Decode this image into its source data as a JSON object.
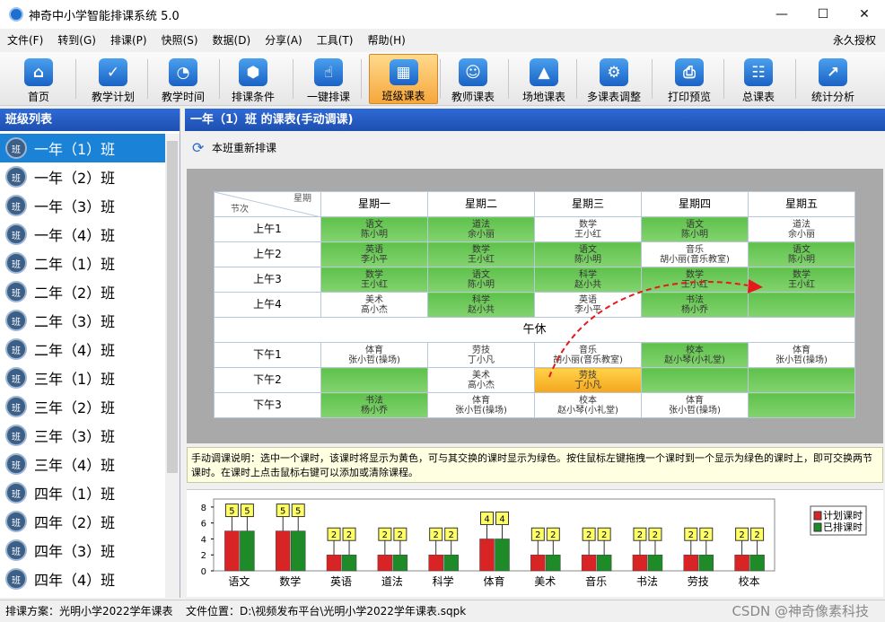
{
  "window": {
    "title": "神奇中小学智能排课系统 5.0",
    "minimize": "—",
    "maximize": "☐",
    "close": "✕"
  },
  "menu": {
    "items": [
      "文件(F)",
      "转到(G)",
      "排课(P)",
      "快照(S)",
      "数据(D)",
      "分享(A)",
      "工具(T)",
      "帮助(H)"
    ],
    "license": "永久授权"
  },
  "toolbar": {
    "buttons": [
      "首页",
      "教学计划",
      "教学时间",
      "排课条件",
      "一键排课",
      "班级课表",
      "教师课表",
      "场地课表",
      "多课表调整",
      "打印预览",
      "总课表",
      "统计分析"
    ],
    "active": "班级课表"
  },
  "left": {
    "title": "班级列表",
    "classes": [
      "一年（1）班",
      "一年（2）班",
      "一年（3）班",
      "一年（4）班",
      "二年（1）班",
      "二年（2）班",
      "二年（3）班",
      "二年（4）班",
      "三年（1）班",
      "三年（2）班",
      "三年（3）班",
      "三年（4）班",
      "四年（1）班",
      "四年（2）班",
      "四年（3）班",
      "四年（4）班"
    ],
    "selected": "一年（1）班",
    "icon_text": "班"
  },
  "right": {
    "title": "一年（1）班 的课表(手动调课)",
    "rebuild": "本班重新排课"
  },
  "schedule": {
    "corner_top": "星期",
    "corner_bottom": "节次",
    "days": [
      "星期一",
      "星期二",
      "星期三",
      "星期四",
      "星期五"
    ],
    "noon": "午休",
    "rows": [
      {
        "label": "上午1",
        "cells": [
          {
            "t": "语文",
            "s": "陈小明",
            "c": "g"
          },
          {
            "t": "道法",
            "s": "余小丽",
            "c": "g"
          },
          {
            "t": "数学",
            "s": "王小红",
            "c": ""
          },
          {
            "t": "语文",
            "s": "陈小明",
            "c": "g"
          },
          {
            "t": "道法",
            "s": "余小丽",
            "c": ""
          }
        ]
      },
      {
        "label": "上午2",
        "cells": [
          {
            "t": "英语",
            "s": "李小平",
            "c": "g"
          },
          {
            "t": "数学",
            "s": "王小红",
            "c": "g"
          },
          {
            "t": "语文",
            "s": "陈小明",
            "c": "g"
          },
          {
            "t": "音乐",
            "s": "胡小丽(音乐教室)",
            "c": ""
          },
          {
            "t": "语文",
            "s": "陈小明",
            "c": "g"
          }
        ]
      },
      {
        "label": "上午3",
        "cells": [
          {
            "t": "数学",
            "s": "王小红",
            "c": "g"
          },
          {
            "t": "语文",
            "s": "陈小明",
            "c": "g"
          },
          {
            "t": "科学",
            "s": "赵小共",
            "c": "g"
          },
          {
            "t": "数学",
            "s": "王小红",
            "c": "g"
          },
          {
            "t": "数学",
            "s": "王小红",
            "c": "g"
          }
        ]
      },
      {
        "label": "上午4",
        "cells": [
          {
            "t": "美术",
            "s": "高小杰",
            "c": ""
          },
          {
            "t": "科学",
            "s": "赵小共",
            "c": "g"
          },
          {
            "t": "英语",
            "s": "李小平",
            "c": ""
          },
          {
            "t": "书法",
            "s": "杨小乔",
            "c": "g"
          },
          {
            "t": "",
            "s": "",
            "c": "g"
          }
        ]
      },
      {
        "label": "下午1",
        "cells": [
          {
            "t": "体育",
            "s": "张小哲(操场)",
            "c": ""
          },
          {
            "t": "劳技",
            "s": "丁小凡",
            "c": ""
          },
          {
            "t": "音乐",
            "s": "胡小丽(音乐教室)",
            "c": ""
          },
          {
            "t": "校本",
            "s": "赵小琴(小礼堂)",
            "c": "g"
          },
          {
            "t": "体育",
            "s": "张小哲(操场)",
            "c": ""
          }
        ]
      },
      {
        "label": "下午2",
        "cells": [
          {
            "t": "",
            "s": "",
            "c": "g"
          },
          {
            "t": "美术",
            "s": "高小杰",
            "c": ""
          },
          {
            "t": "劳技",
            "s": "丁小凡",
            "c": "y"
          },
          {
            "t": "",
            "s": "",
            "c": "g"
          },
          {
            "t": "",
            "s": "",
            "c": "g"
          }
        ]
      },
      {
        "label": "下午3",
        "cells": [
          {
            "t": "书法",
            "s": "杨小乔",
            "c": "g"
          },
          {
            "t": "体育",
            "s": "张小哲(操场)",
            "c": ""
          },
          {
            "t": "校本",
            "s": "赵小琴(小礼堂)",
            "c": ""
          },
          {
            "t": "体育",
            "s": "张小哲(操场)",
            "c": ""
          },
          {
            "t": "",
            "s": "",
            "c": "g"
          }
        ]
      }
    ]
  },
  "notice": "手动调课说明：选中一个课时，该课时将显示为黄色，可与其交换的课时显示为绿色。按住鼠标左键拖拽一个课时到一个显示为绿色的课时上，即可交换两节课时。在课时上点击鼠标右键可以添加或清除课程。",
  "chart_data": {
    "type": "bar",
    "categories": [
      "语文",
      "数学",
      "英语",
      "道法",
      "科学",
      "体育",
      "美术",
      "音乐",
      "书法",
      "劳技",
      "校本"
    ],
    "series": [
      {
        "name": "计划课时",
        "values": [
          5,
          5,
          2,
          2,
          2,
          4,
          2,
          2,
          2,
          2,
          2
        ],
        "color": "#d82424"
      },
      {
        "name": "已排课时",
        "values": [
          5,
          5,
          2,
          2,
          2,
          4,
          2,
          2,
          2,
          2,
          2
        ],
        "color": "#1e8a28"
      }
    ],
    "yticks": [
      0,
      2,
      4,
      6,
      8
    ],
    "ylim": [
      0,
      9
    ],
    "legend": "right"
  },
  "status": {
    "plan": "排课方案：光明小学2022学年课表",
    "file": "文件位置：D:\\视频发布平台\\光明小学2022学年课表.sqpk",
    "watermark": "CSDN @神奇像素科技"
  }
}
